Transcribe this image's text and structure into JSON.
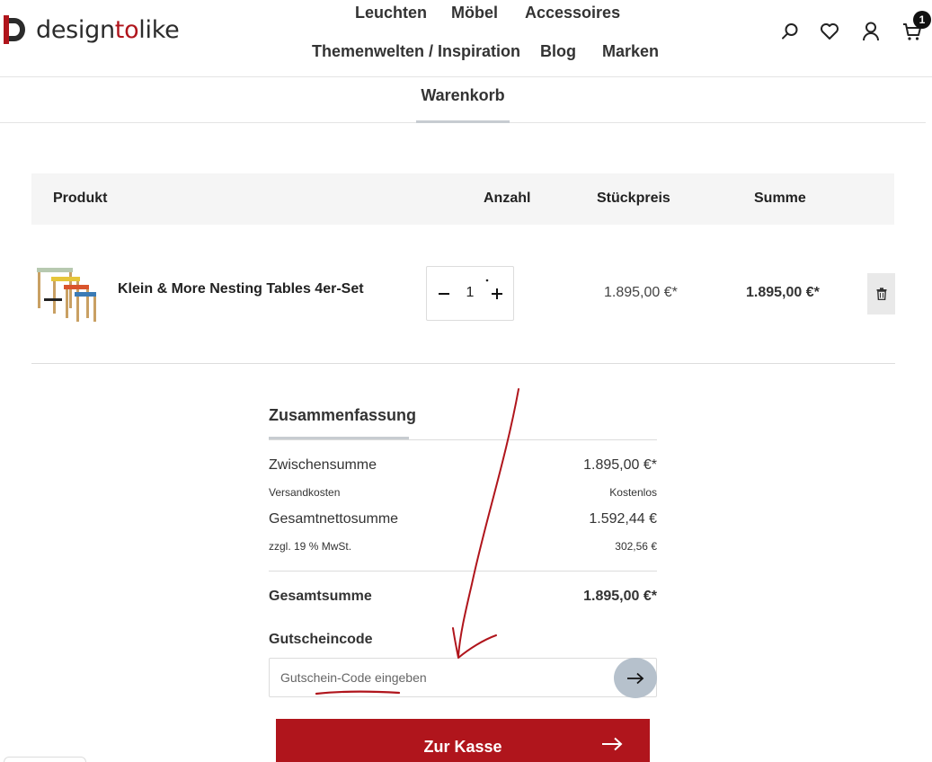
{
  "brand": {
    "name_prefix": "design",
    "name_accent": "to",
    "name_suffix": "like",
    "accent_color": "#b0151c"
  },
  "nav": {
    "row1": [
      "Leuchten",
      "Möbel",
      "Accessoires"
    ],
    "row2": [
      "Themenwelten / Inspiration",
      "Blog",
      "Marken"
    ]
  },
  "header_icons": {
    "search": "search-icon",
    "wishlist": "heart-icon",
    "account": "user-icon",
    "cart": "cart-icon",
    "cart_count": "1"
  },
  "tab": {
    "label": "Warenkorb"
  },
  "table": {
    "headers": {
      "product": "Produkt",
      "quantity": "Anzahl",
      "unit_price": "Stückpreis",
      "total": "Summe"
    },
    "items": [
      {
        "name": "Klein & More Nesting Tables 4er-Set",
        "quantity": "1",
        "unit_price": "1.895,00 €*",
        "total": "1.895,00 €*"
      }
    ]
  },
  "summary": {
    "title": "Zusammenfassung",
    "subtotal_label": "Zwischensumme",
    "subtotal_value": "1.895,00 €*",
    "shipping_label": "Versandkosten",
    "shipping_value": "Kostenlos",
    "net_label": "Gesamtnettosumme",
    "net_value": "1.592,44 €",
    "tax_label": "zzgl. 19 % MwSt.",
    "tax_value": "302,56 €",
    "total_label": "Gesamtsumme",
    "total_value": "1.895,00 €*"
  },
  "coupon": {
    "label": "Gutscheincode",
    "placeholder": "Gutschein-Code eingeben",
    "submit_icon": "arrow-right-icon"
  },
  "checkout": {
    "label": "Zur Kasse"
  },
  "colors": {
    "checkout_bg": "#b0151c",
    "annotation": "#b0151c",
    "coupon_submit_bg": "#b6c1cc",
    "table_head_bg": "#f5f5f5"
  }
}
